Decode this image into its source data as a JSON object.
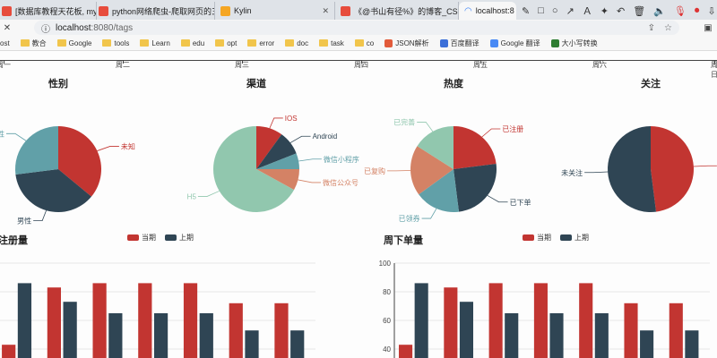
{
  "browser": {
    "tabs": [
      {
        "label": "[数据库教程天花板, mys",
        "icon_color": "#e74c3c"
      },
      {
        "label": "python网络爬虫-爬取网页的三",
        "icon_color": "#e74c3c"
      },
      {
        "label": "Kylin",
        "icon_color": "#f5a623"
      },
      {
        "label": "《@书山有径%》的博客_CSDN",
        "icon_color": "#e74c3c"
      },
      {
        "label": "localhost:8",
        "icon_color": "#3b82f6"
      }
    ],
    "active_tab": 4,
    "url_host": "localhost",
    "url_rest": ":8080/tags",
    "bookmarks": [
      {
        "label": "ost",
        "kind": "none"
      },
      {
        "label": "教合",
        "kind": "folder"
      },
      {
        "label": "Google",
        "kind": "folder"
      },
      {
        "label": "tools",
        "kind": "folder"
      },
      {
        "label": "Learn",
        "kind": "folder"
      },
      {
        "label": "edu",
        "kind": "folder"
      },
      {
        "label": "opt",
        "kind": "folder"
      },
      {
        "label": "error",
        "kind": "folder"
      },
      {
        "label": "doc",
        "kind": "folder"
      },
      {
        "label": "task",
        "kind": "folder"
      },
      {
        "label": "co",
        "kind": "folder"
      },
      {
        "label": "JSON解析",
        "kind": "json"
      },
      {
        "label": "百度翻译",
        "kind": "baidu"
      },
      {
        "label": "Google 翻译",
        "kind": "gtrans"
      },
      {
        "label": "大小写转换",
        "kind": "case"
      }
    ]
  },
  "weekdays": [
    "周一",
    "周二",
    "周三",
    "周四",
    "周五",
    "周六",
    "周日"
  ],
  "colors": {
    "red": "#c23531",
    "navy": "#2f4554",
    "teal": "#61a0a8",
    "orange": "#d48265",
    "green": "#91c7ae"
  },
  "chart_data": [
    {
      "type": "pie",
      "title": "性别",
      "slices": [
        {
          "name": "未知",
          "value": 36
        },
        {
          "name": "男性",
          "value": 37
        },
        {
          "name": "女性",
          "value": 27
        }
      ]
    },
    {
      "type": "pie",
      "title": "渠道",
      "slices": [
        {
          "name": "IOS",
          "value": 10
        },
        {
          "name": "Android",
          "value": 9
        },
        {
          "name": "微信小程序",
          "value": 6
        },
        {
          "name": "微信公众号",
          "value": 8
        },
        {
          "name": "H5",
          "value": 67
        }
      ]
    },
    {
      "type": "pie",
      "title": "热度",
      "slices": [
        {
          "name": "已注册",
          "value": 23
        },
        {
          "name": "已下单",
          "value": 25
        },
        {
          "name": "已领券",
          "value": 17
        },
        {
          "name": "已复购",
          "value": 19
        },
        {
          "name": "已完善",
          "value": 16
        }
      ]
    },
    {
      "type": "pie",
      "title": "关注",
      "slices": [
        {
          "name": "已关注",
          "value": 48
        },
        {
          "name": "未关注",
          "value": 52
        }
      ]
    },
    {
      "type": "bar",
      "title": "注册量",
      "legend": [
        "当期",
        "上期"
      ],
      "series": [
        {
          "name": "当期",
          "values": [
            43,
            83,
            86,
            86,
            86,
            72,
            72
          ]
        },
        {
          "name": "上期",
          "values": [
            86,
            73,
            65,
            65,
            65,
            53,
            53
          ]
        }
      ]
    },
    {
      "type": "bar",
      "title": "周下单量",
      "legend": [
        "当期",
        "上期"
      ],
      "ylim": [
        40,
        100
      ],
      "yticks": [
        40,
        60,
        80,
        100
      ],
      "series": [
        {
          "name": "当期",
          "values": [
            43,
            83,
            86,
            86,
            86,
            72,
            72
          ]
        },
        {
          "name": "上期",
          "values": [
            86,
            73,
            65,
            65,
            65,
            53,
            53
          ]
        }
      ]
    }
  ]
}
